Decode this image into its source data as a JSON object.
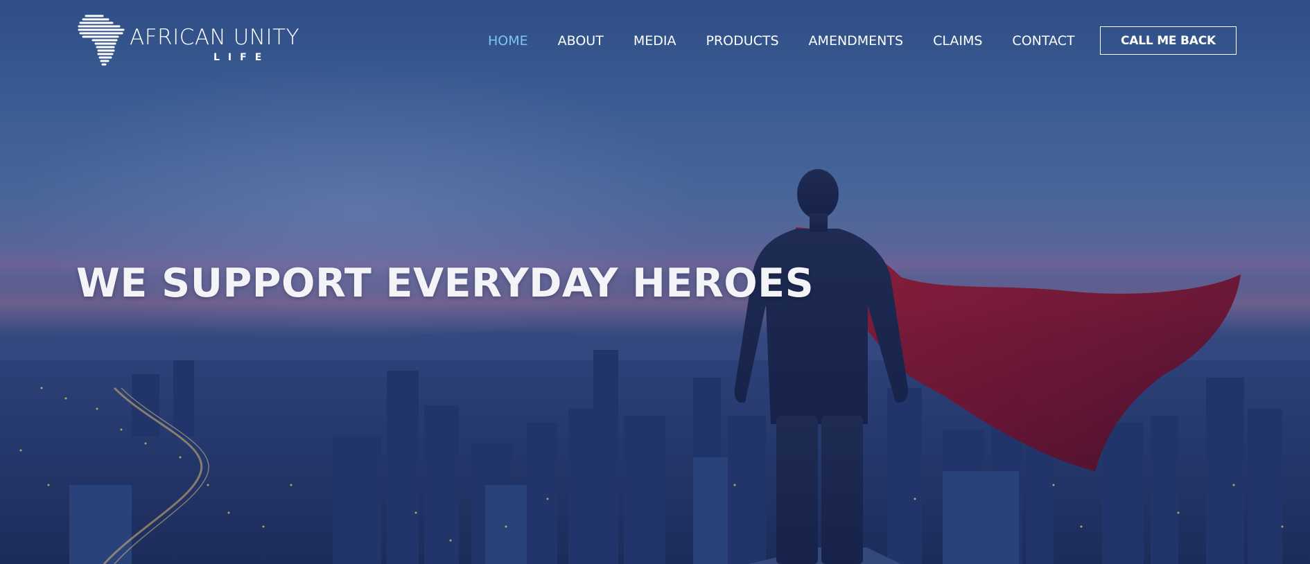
{
  "brand": {
    "name_main": "AFRICAN UNITY",
    "name_sub": "LIFE",
    "logo_icon": "africa-continent-icon"
  },
  "nav": {
    "items": [
      {
        "label": "HOME",
        "active": true
      },
      {
        "label": "ABOUT",
        "active": false
      },
      {
        "label": "MEDIA",
        "active": false
      },
      {
        "label": "PRODUCTS",
        "active": false
      },
      {
        "label": "AMENDMENTS",
        "active": false
      },
      {
        "label": "CLAIMS",
        "active": false
      },
      {
        "label": "CONTACT",
        "active": false
      }
    ],
    "cta_label": "CALL ME BACK"
  },
  "hero": {
    "title": "WE SUPPORT EVERYDAY HEROES",
    "image": "hero-with-red-cape-over-city-at-dusk"
  },
  "colors": {
    "active_nav": "#7cc6f0",
    "text": "#ffffff",
    "overlay": "#2f4d86",
    "cape": "#7a1530"
  }
}
